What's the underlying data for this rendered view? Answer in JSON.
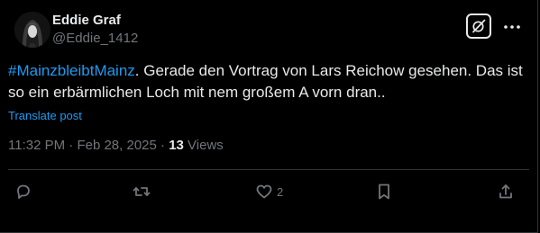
{
  "tweet": {
    "author_name": "Eddie Graf",
    "author_handle": "@Eddie_1412",
    "hashtag": "#MainzbleibtMainz",
    "text_rest": ". Gerade den Vortrag von Lars Reichow gesehen. Das ist so ein erbärmlichen Loch mit nem großem A vorn dran..",
    "translate_label": "Translate post",
    "time": "11:32 PM",
    "separator": "·",
    "date": "Feb 28, 2025",
    "views_count": "13",
    "views_label": "Views"
  },
  "actions": {
    "reply_count": "",
    "repost_count": "",
    "like_count": "2"
  },
  "icons": {
    "grok": "grok-icon",
    "more": "more-icon",
    "reply": "reply-icon",
    "repost": "repost-icon",
    "like": "heart-icon",
    "bookmark": "bookmark-icon",
    "share": "share-icon"
  },
  "colors": {
    "background": "#000000",
    "text": "#e7e9ea",
    "secondary": "#71767b",
    "link": "#1d9bf0",
    "border": "#2f3336"
  }
}
